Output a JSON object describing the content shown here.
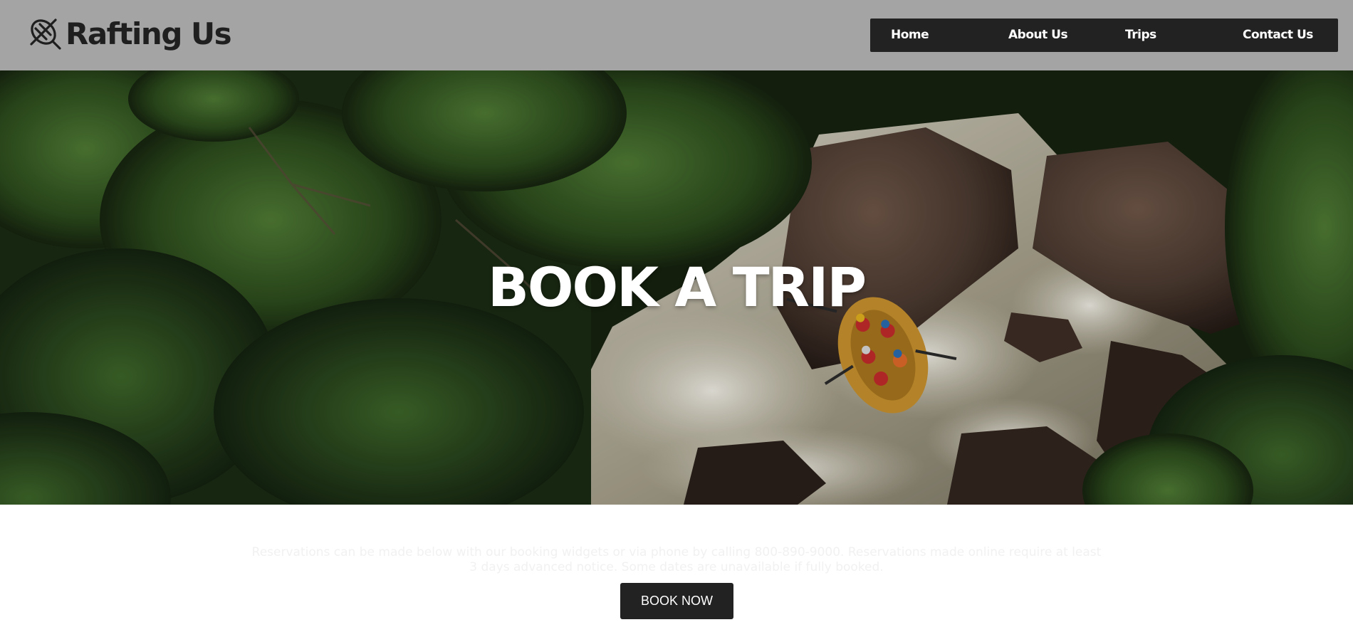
{
  "header": {
    "brand": "Rafting Us",
    "logo_icon": "raft-paddle-icon",
    "background_color": "#a4a4a4",
    "nav": {
      "home": "Home",
      "about": "About Us",
      "trips": "Trips",
      "contact": "Contact Us"
    }
  },
  "hero": {
    "title": "BOOK A TRIP",
    "image_subject": "aerial photo of a yellow raft in whitewater rapids between boulders and jungle"
  },
  "content": {
    "intro": "Reservations can be made below with our booking widgets or via phone by calling 800-890-9000. Reservations made online require at least 3 days advanced notice. Some dates are unavailable if fully booked.",
    "book_button": "BOOK NOW"
  },
  "colors": {
    "nav_background": "#222222",
    "button_background": "#222222",
    "text_dark": "#1f1f1f"
  }
}
